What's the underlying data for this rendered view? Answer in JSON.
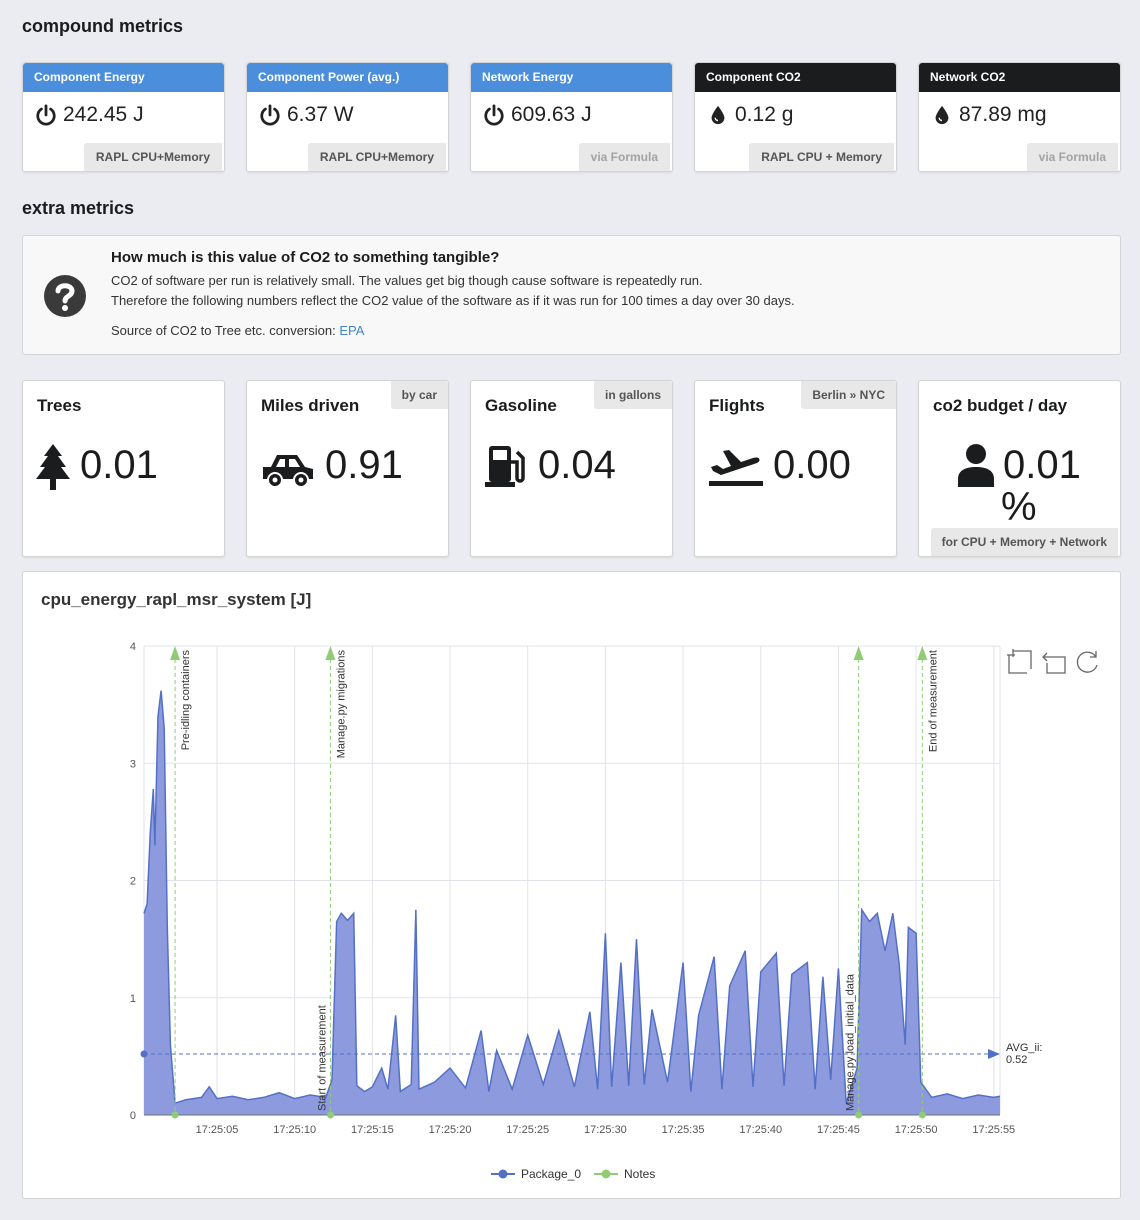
{
  "sections": {
    "compound_title": "compound metrics",
    "extra_title": "extra metrics"
  },
  "metrics": [
    {
      "label": "Component Energy",
      "value": "242.45 J",
      "source": "RAPL CPU+Memory",
      "header_color": "#4a8edc",
      "icon": "power-icon"
    },
    {
      "label": "Component Power (avg.)",
      "value": "6.37 W",
      "source": "RAPL CPU+Memory",
      "header_color": "#4a8edc",
      "icon": "power-icon"
    },
    {
      "label": "Network Energy",
      "value": "609.63 J",
      "source": "via Formula",
      "header_color": "#4a8edc",
      "icon": "power-icon"
    },
    {
      "label": "Component CO2",
      "value": "0.12 g",
      "source": "RAPL CPU + Memory",
      "header_color": "#1b1c1d",
      "icon": "drop-icon"
    },
    {
      "label": "Network CO2",
      "value": "87.89 mg",
      "source": "via Formula",
      "header_color": "#1b1c1d",
      "icon": "drop-icon"
    }
  ],
  "info": {
    "title": "How much is this value of CO2 to something tangible?",
    "line1": "CO2 of software per run is relatively small. The values get big though cause software is repeatedly run.",
    "line2": "Therefore the following numbers reflect the CO2 value of the software as if it was run for 100 times a day over 30 days.",
    "source_prefix": "Source of CO2 to Tree etc. conversion:",
    "source_link": "EPA"
  },
  "equivalents": [
    {
      "title": "Trees",
      "value": "0.01",
      "tag": "",
      "icon": "tree-icon"
    },
    {
      "title": "Miles driven",
      "value": "0.91",
      "tag": "by car",
      "icon": "car-icon"
    },
    {
      "title": "Gasoline",
      "value": "0.04",
      "tag": "in gallons",
      "icon": "gas-pump-icon"
    },
    {
      "title": "Flights",
      "value": "0.00",
      "tag": "Berlin » NYC",
      "icon": "plane-icon"
    },
    {
      "title": "co2 budget / day",
      "value": "0.01",
      "unit": "%",
      "tag": "for CPU + Memory + Network",
      "icon": "user-icon"
    }
  ],
  "chart_data": {
    "type": "area",
    "title": "cpu_energy_rapl_msr_system [J]",
    "ylim": [
      0,
      4
    ],
    "yticks": [
      "0",
      "1",
      "2",
      "3",
      "4"
    ],
    "x_range": [
      "17:25:00.3",
      "17:25:55.4"
    ],
    "xticks": [
      "17:25:05",
      "17:25:10",
      "17:25:15",
      "17:25:20",
      "17:25:25",
      "17:25:30",
      "17:25:35",
      "17:25:40",
      "17:25:45",
      "17:25:50",
      "17:25:55"
    ],
    "series": [
      {
        "name": "Package_0",
        "color": "#5470c6",
        "fill": "#8796dc",
        "points": [
          [
            "17:25:00.3",
            1.72
          ],
          [
            "17:25:00.5",
            1.8
          ],
          [
            "17:25:00.7",
            2.4
          ],
          [
            "17:25:00.9",
            2.78
          ],
          [
            "17:25:01.0",
            2.3
          ],
          [
            "17:25:01.2",
            3.4
          ],
          [
            "17:25:01.4",
            3.62
          ],
          [
            "17:25:01.6",
            3.3
          ],
          [
            "17:25:01.8",
            1.6
          ],
          [
            "17:25:02.0",
            0.6
          ],
          [
            "17:25:02.3",
            0.1
          ],
          [
            "17:25:03",
            0.13
          ],
          [
            "17:25:04",
            0.15
          ],
          [
            "17:25:04.5",
            0.24
          ],
          [
            "17:25:05",
            0.14
          ],
          [
            "17:25:06",
            0.16
          ],
          [
            "17:25:07",
            0.13
          ],
          [
            "17:25:08",
            0.15
          ],
          [
            "17:25:09",
            0.19
          ],
          [
            "17:25:10",
            0.14
          ],
          [
            "17:25:11",
            0.17
          ],
          [
            "17:25:12",
            0.15
          ],
          [
            "17:25:12.4",
            0.3
          ],
          [
            "17:25:12.7",
            1.65
          ],
          [
            "17:25:13",
            1.72
          ],
          [
            "17:25:13.4",
            1.66
          ],
          [
            "17:25:13.8",
            1.72
          ],
          [
            "17:25:14.0",
            0.25
          ],
          [
            "17:25:14.5",
            0.2
          ],
          [
            "17:25:15",
            0.24
          ],
          [
            "17:25:15.6",
            0.4
          ],
          [
            "17:25:16",
            0.22
          ],
          [
            "17:25:16.5",
            0.85
          ],
          [
            "17:25:16.8",
            0.2
          ],
          [
            "17:25:17.5",
            0.26
          ],
          [
            "17:25:17.8",
            1.75
          ],
          [
            "17:25:18.0",
            0.22
          ],
          [
            "17:25:19",
            0.28
          ],
          [
            "17:25:20",
            0.4
          ],
          [
            "17:25:21",
            0.23
          ],
          [
            "17:25:22",
            0.72
          ],
          [
            "17:25:22.5",
            0.2
          ],
          [
            "17:25:23",
            0.55
          ],
          [
            "17:25:24",
            0.22
          ],
          [
            "17:25:25",
            0.68
          ],
          [
            "17:25:26",
            0.26
          ],
          [
            "17:25:27",
            0.72
          ],
          [
            "17:25:28",
            0.24
          ],
          [
            "17:25:29",
            0.88
          ],
          [
            "17:25:29.5",
            0.22
          ],
          [
            "17:25:30",
            1.55
          ],
          [
            "17:25:30.4",
            0.24
          ],
          [
            "17:25:31",
            1.3
          ],
          [
            "17:25:31.5",
            0.25
          ],
          [
            "17:25:32",
            1.5
          ],
          [
            "17:25:32.5",
            0.26
          ],
          [
            "17:25:33",
            0.9
          ],
          [
            "17:25:34",
            0.28
          ],
          [
            "17:25:35",
            1.3
          ],
          [
            "17:25:35.5",
            0.2
          ],
          [
            "17:25:36",
            0.85
          ],
          [
            "17:25:37",
            1.35
          ],
          [
            "17:25:37.5",
            0.22
          ],
          [
            "17:25:38",
            1.1
          ],
          [
            "17:25:39",
            1.4
          ],
          [
            "17:25:39.5",
            0.24
          ],
          [
            "17:25:40",
            1.22
          ],
          [
            "17:25:41",
            1.38
          ],
          [
            "17:25:41.5",
            0.25
          ],
          [
            "17:25:42",
            1.2
          ],
          [
            "17:25:43",
            1.3
          ],
          [
            "17:25:43.5",
            0.22
          ],
          [
            "17:25:44",
            1.18
          ],
          [
            "17:25:44.5",
            0.3
          ],
          [
            "17:25:45",
            1.25
          ],
          [
            "17:25:45.5",
            0.1
          ],
          [
            "17:25:46.2",
            0.4
          ],
          [
            "17:25:46.5",
            1.75
          ],
          [
            "17:25:47",
            1.65
          ],
          [
            "17:25:47.5",
            1.72
          ],
          [
            "17:25:48",
            1.4
          ],
          [
            "17:25:48.5",
            1.72
          ],
          [
            "17:25:48.9",
            1.3
          ],
          [
            "17:25:49.3",
            0.6
          ],
          [
            "17:25:49.5",
            1.6
          ],
          [
            "17:25:50",
            1.55
          ],
          [
            "17:25:50.3",
            0.28
          ],
          [
            "17:25:51",
            0.15
          ],
          [
            "17:25:52",
            0.18
          ],
          [
            "17:25:53",
            0.14
          ],
          [
            "17:25:54",
            0.17
          ],
          [
            "17:25:55",
            0.15
          ],
          [
            "17:25:55.4",
            0.16
          ]
        ]
      }
    ],
    "average": {
      "label": "AVG_ii:",
      "value": "0.52",
      "y": 0.52
    },
    "notes": [
      {
        "x": "17:25:02.3",
        "label": "Pre-idling containers"
      },
      {
        "x": "17:25:12.3",
        "label": "Start of measurement"
      },
      {
        "x": "17:25:12.3",
        "label": "Manage.py migrations"
      },
      {
        "x": "17:25:46.3",
        "label": "Manage.py load_initial_data"
      },
      {
        "x": "17:25:50.4",
        "label": "End of measurement"
      }
    ],
    "legend": [
      "Package_0",
      "Notes"
    ],
    "notes_color": "#91cc75",
    "legend_position": "bottom-center"
  }
}
